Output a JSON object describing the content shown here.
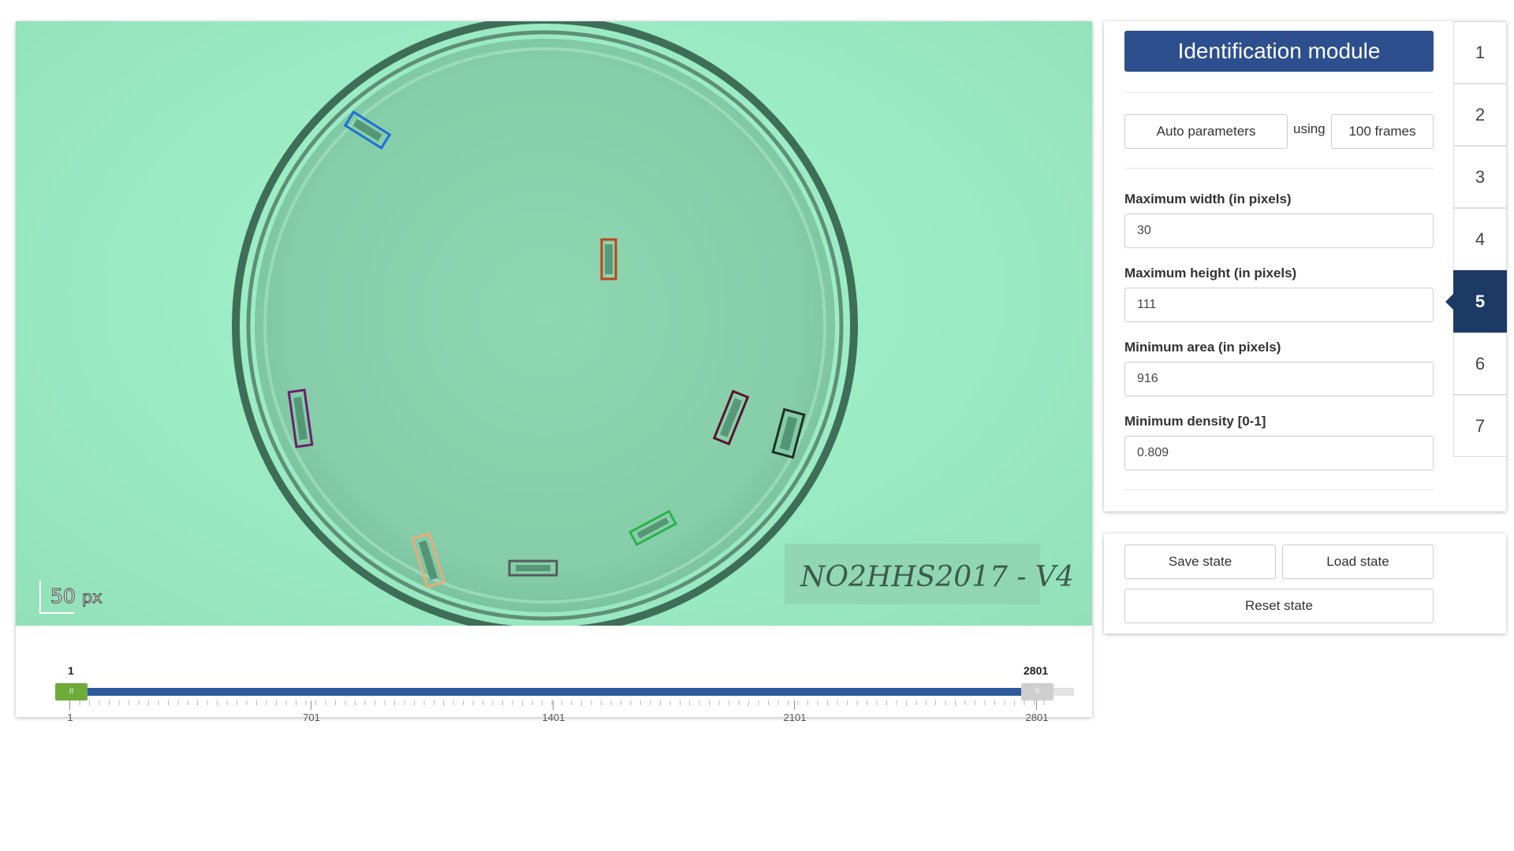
{
  "viewer": {
    "scale_value": "50",
    "scale_unit": "px",
    "plate_label": "NO2HHS2017 - V4",
    "range_start_label": "1",
    "range_end_label": "2801",
    "ticks": [
      "1",
      "701",
      "1401",
      "2101",
      "2801"
    ],
    "handle_grip": "II",
    "range": {
      "min": 1,
      "max": 2801,
      "start": 1,
      "end": 2801
    }
  },
  "detections": [
    {
      "color": "#1e6fd9"
    },
    {
      "color": "#c0441a"
    },
    {
      "color": "#6b1f6e"
    },
    {
      "color": "#5a1230"
    },
    {
      "color": "#1f2f2a"
    },
    {
      "color": "#2bb34a"
    },
    {
      "color": "#f0a878"
    },
    {
      "color": "#555b5e"
    }
  ],
  "module": {
    "title": "Identification module",
    "auto_parameters_label": "Auto parameters",
    "using_label": "using",
    "frames_label": "100 frames",
    "fields": [
      {
        "label": "Maximum width (in pixels)",
        "value": "30"
      },
      {
        "label": "Maximum height (in pixels)",
        "value": "111"
      },
      {
        "label": "Minimum area (in pixels)",
        "value": "916"
      },
      {
        "label": "Minimum density [0-1]",
        "value": "0.809"
      }
    ]
  },
  "steps": [
    "1",
    "2",
    "3",
    "4",
    "5",
    "6",
    "7"
  ],
  "active_step": "5",
  "state": {
    "save_label": "Save state",
    "load_label": "Load state",
    "reset_label": "Reset state"
  },
  "colors": {
    "accent": "#2d4f8e",
    "active_step": "#1d3a66",
    "slider_fill": "#2e5a9c",
    "slider_start_handle": "#6eab3a"
  }
}
